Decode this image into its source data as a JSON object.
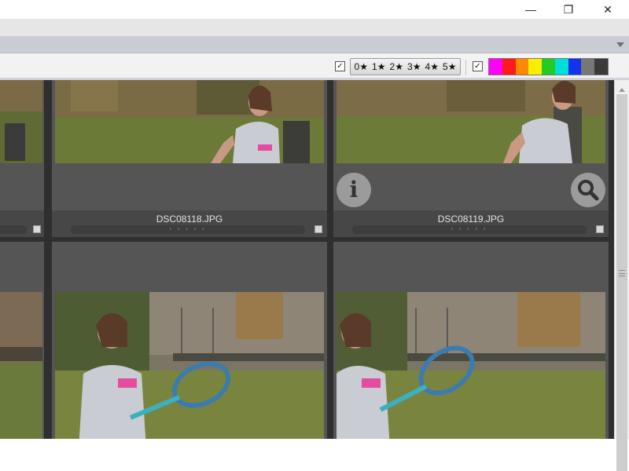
{
  "window": {
    "minimize": "—",
    "maximize": "❐",
    "close": "✕"
  },
  "filters": {
    "stars_checked": "✓",
    "colors_checked": "✓",
    "stars": [
      "0★",
      "1★",
      "2★",
      "3★",
      "4★",
      "5★"
    ],
    "colors": [
      "#ff00ff",
      "#ff1a1a",
      "#ff8800",
      "#ffee00",
      "#22cc22",
      "#00dddd",
      "#1133ee",
      "#777777",
      "#3a3a3a"
    ]
  },
  "grid": {
    "items": [
      {
        "filename": "DSC08118.JPG",
        "rating_dots": "• • • • •"
      },
      {
        "filename": "DSC08119.JPG",
        "rating_dots": "• • • • •"
      }
    ]
  },
  "overlay": {
    "info_glyph": "i",
    "zoom_glyph": "🔍"
  }
}
